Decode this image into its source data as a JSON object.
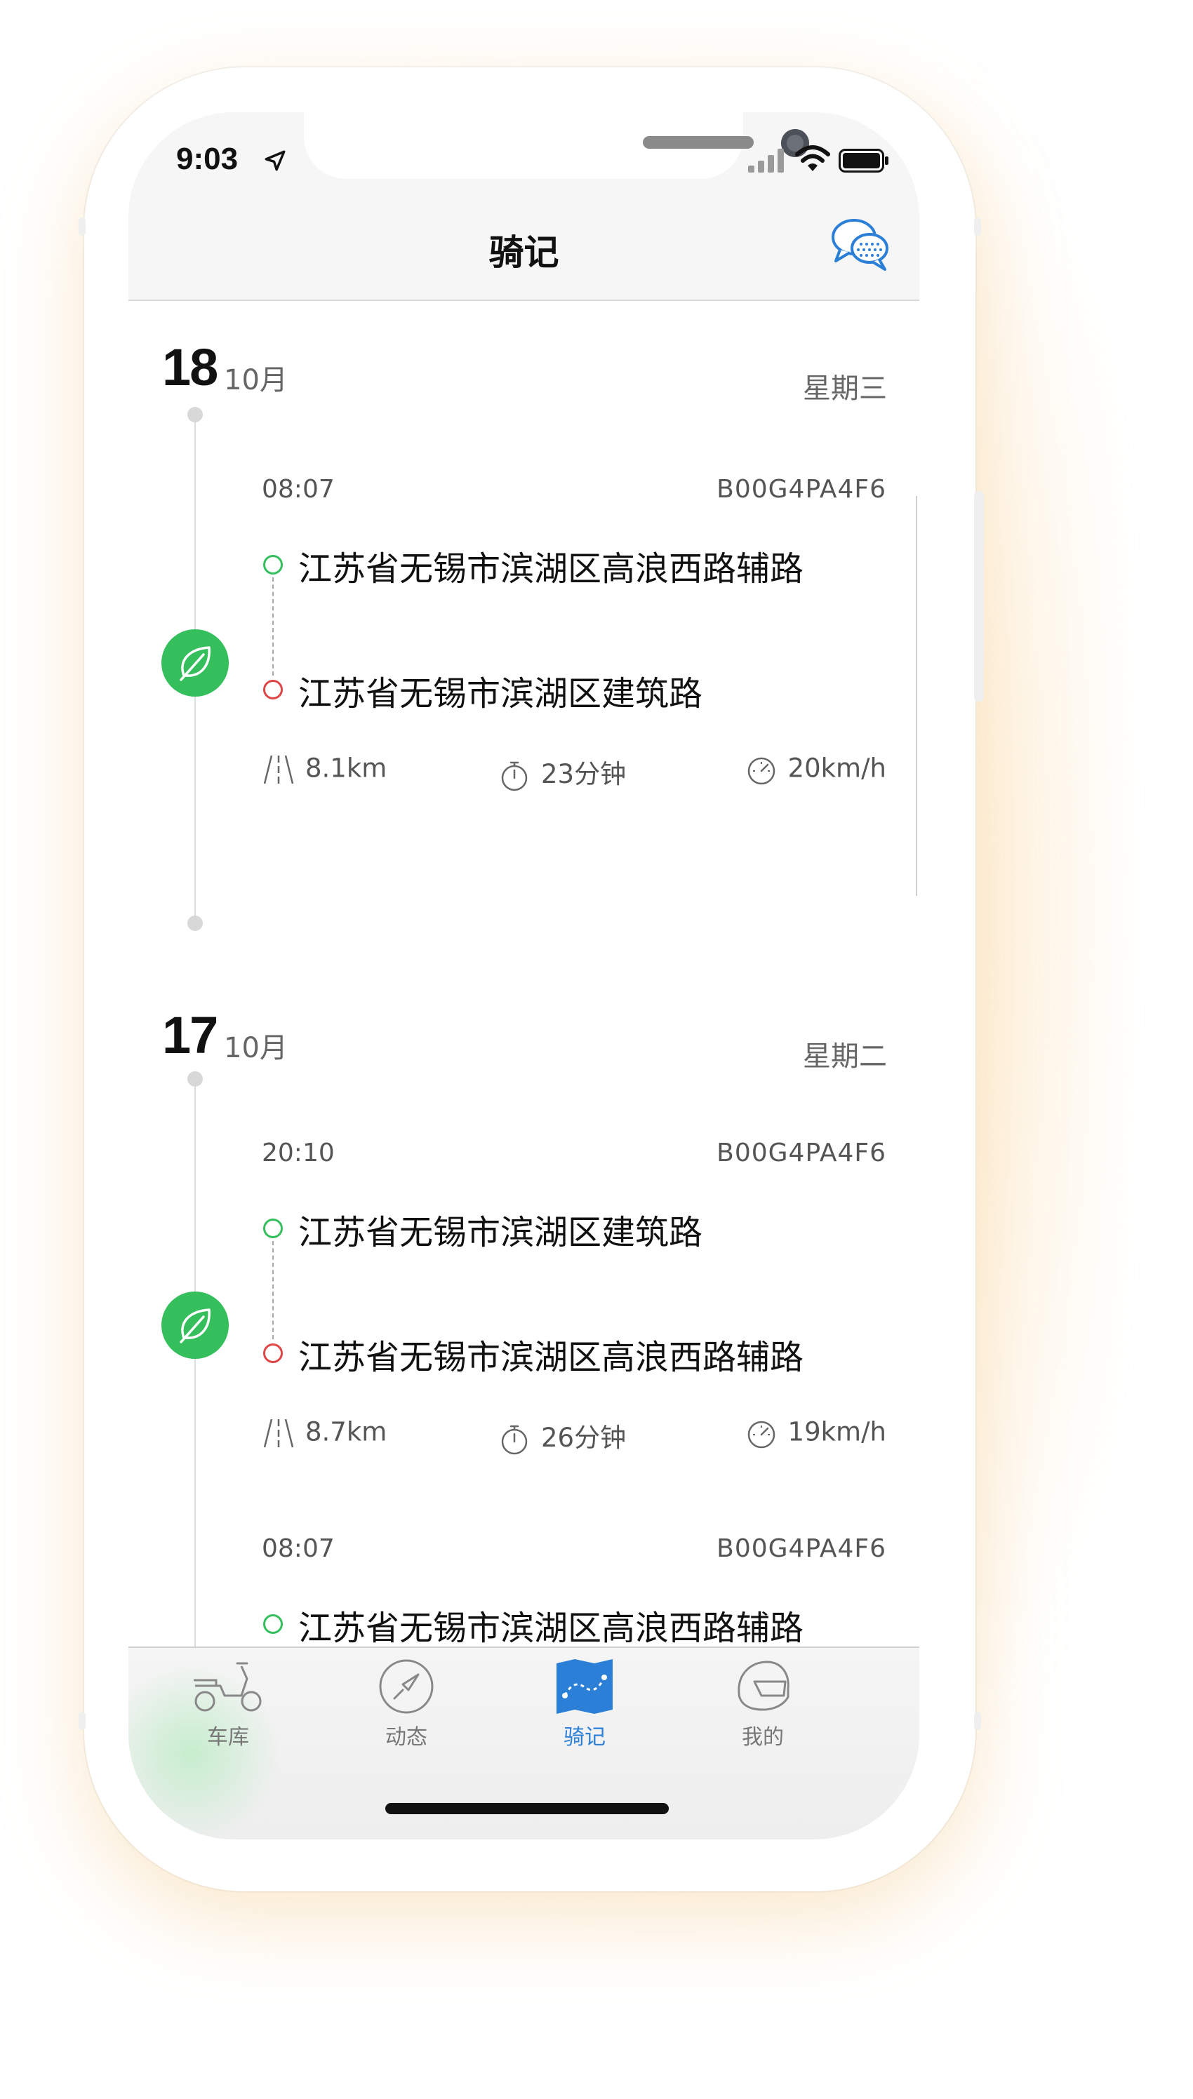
{
  "status_bar": {
    "time": "9:03"
  },
  "nav": {
    "title": "骑记"
  },
  "days": [
    {
      "day": "18",
      "month": "10月",
      "weekday": "星期三",
      "trips": [
        {
          "time": "08:07",
          "plate": "B00G4PA4F6",
          "start": "江苏省无锡市滨湖区高浪西路辅路",
          "end": "江苏省无锡市滨湖区建筑路",
          "distance": "8.1km",
          "duration": "23分钟",
          "speed": "20km/h"
        }
      ]
    },
    {
      "day": "17",
      "month": "10月",
      "weekday": "星期二",
      "trips": [
        {
          "time": "20:10",
          "plate": "B00G4PA4F6",
          "start": "江苏省无锡市滨湖区建筑路",
          "end": "江苏省无锡市滨湖区高浪西路辅路",
          "distance": "8.7km",
          "duration": "26分钟",
          "speed": "19km/h"
        },
        {
          "time": "08:07",
          "plate": "B00G4PA4F6",
          "start": "江苏省无锡市滨湖区高浪西路辅路"
        }
      ]
    }
  ],
  "tabs": [
    {
      "label": "车库",
      "icon": "scooter-icon",
      "active": false
    },
    {
      "label": "动态",
      "icon": "compass-icon",
      "active": false
    },
    {
      "label": "骑记",
      "icon": "map-icon",
      "active": true
    },
    {
      "label": "我的",
      "icon": "helmet-icon",
      "active": false
    }
  ],
  "colors": {
    "accent_blue": "#2b7fd6",
    "leaf_green": "#35bf5c",
    "start_green": "#35bf5c",
    "end_red": "#e04646"
  }
}
